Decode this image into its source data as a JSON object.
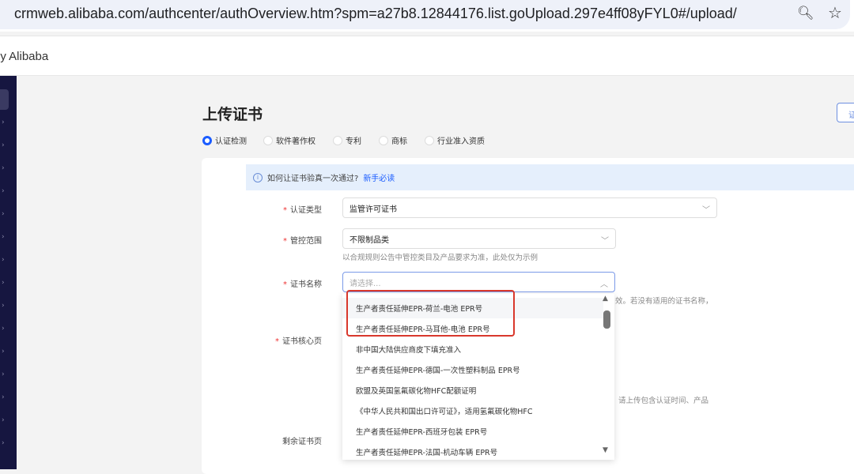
{
  "browser": {
    "url": "crmweb.alibaba.com/authcenter/authOverview.htm?spm=a27b8.12844176.list.goUpload.297e4ff08yFYL0#/upload/",
    "zoom_icon": "zoom-out-icon",
    "star_icon": "star-icon"
  },
  "header": {
    "brand": "ly Alibaba"
  },
  "page": {
    "title": "上传证书",
    "top_right_button": "证"
  },
  "radios": [
    {
      "label": "认证检测",
      "checked": true
    },
    {
      "label": "软件著作权",
      "checked": false
    },
    {
      "label": "专利",
      "checked": false
    },
    {
      "label": "商标",
      "checked": false
    },
    {
      "label": "行业准入资质",
      "checked": false
    }
  ],
  "info": {
    "text": "如何让证书验真一次通过?",
    "link": "新手必读"
  },
  "form": {
    "cert_type": {
      "label": "认证类型",
      "value": "监管许可证书"
    },
    "scope": {
      "label": "管控范围",
      "value": "不限制品类",
      "hint": "以合规规则公告中管控类目及产品要求为准，此处仅为示例"
    },
    "cert_name": {
      "label": "证书名称",
      "placeholder": "请选择...",
      "hint": "效。若没有适用的证书名称，"
    },
    "core_page": {
      "label": "证书核心页",
      "hint": "请上传包含认证时间、产品"
    },
    "rest_page": {
      "label": "剩余证书页"
    }
  },
  "dropdown": {
    "options": [
      "生产者责任延伸EPR-荷兰-电池 EPR号",
      "生产者责任延伸EPR-马耳他-电池 EPR号",
      "非中国大陆供应商皮下填充准入",
      "生产者责任延伸EPR-德国-一次性塑料制品 EPR号",
      "欧盟及英国氢氟碳化物HFC配额证明",
      "《中华人民共和国出口许可证》，适用氢氟碳化物HFC",
      "生产者责任延伸EPR-西班牙包装 EPR号",
      "生产者责任延伸EPR-法国-机动车辆 EPR号"
    ]
  }
}
